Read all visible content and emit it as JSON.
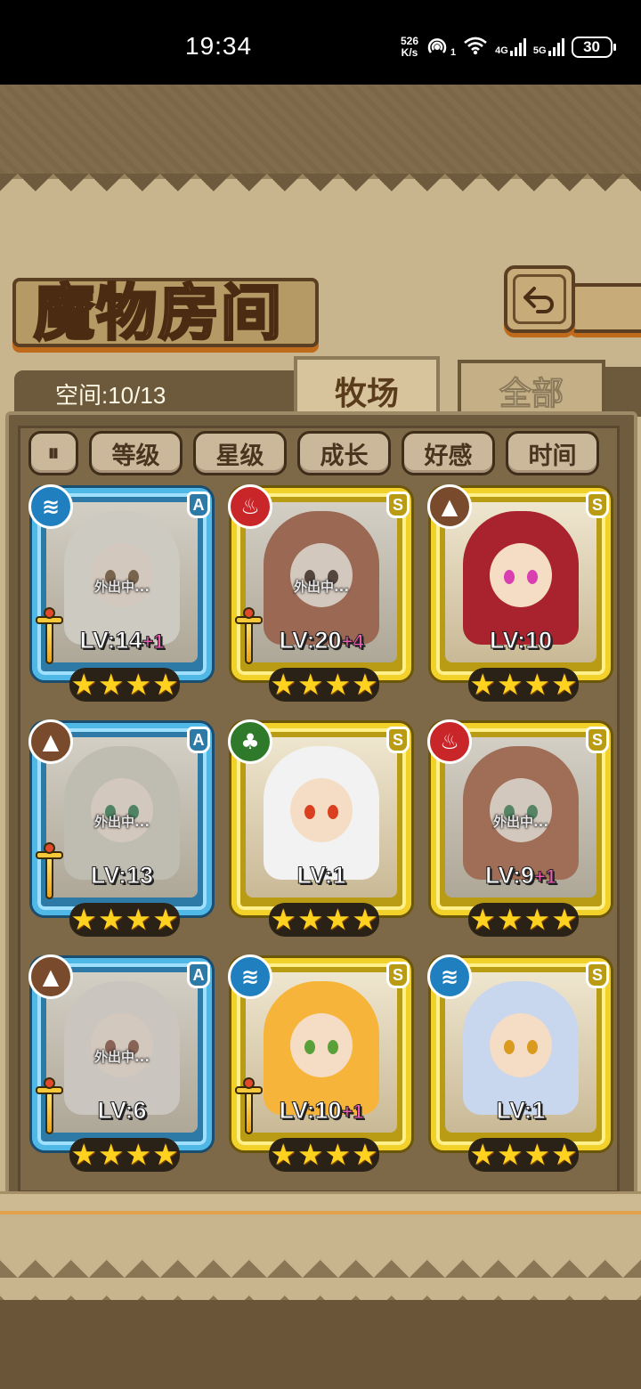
{
  "status_bar": {
    "time": "19:34",
    "net_speed_value": "526",
    "net_speed_unit": "K/s",
    "hotspot_badge": "1",
    "sim1_label": "4G",
    "sim2_label": "5G",
    "battery": "30"
  },
  "header": {
    "title": "魔物房间",
    "back_icon": "back-arrow-icon"
  },
  "space": {
    "label": "空间:10/13"
  },
  "tabs": [
    {
      "label": "牧场",
      "active": true
    },
    {
      "label": "全部",
      "active": false
    }
  ],
  "filters": {
    "sort_icon": "sort-toggle-icon",
    "sort_glyph": "⏸",
    "buttons": [
      "等级",
      "星级",
      "成长",
      "好感",
      "时间"
    ]
  },
  "monster_cards": [
    {
      "rank": "A",
      "element": "water",
      "element_icon": "water-element-icon",
      "element_glyph": "≋",
      "element_color": "#1f7fbf",
      "status": "外出中...",
      "level": "LV:14",
      "bonus": "+1",
      "has_weapon": true,
      "stars": 4,
      "hair_color": "#e8e0cc",
      "eye_color": "#9a6b3a"
    },
    {
      "rank": "S",
      "element": "fire",
      "element_icon": "fire-element-icon",
      "element_glyph": "♨",
      "element_color": "#c9262a",
      "status": "外出中...",
      "level": "LV:20",
      "bonus": "+4",
      "has_weapon": true,
      "stars": 4,
      "hair_color": "#d96a3a",
      "eye_color": "#6b4a3a"
    },
    {
      "rank": "S",
      "element": "earth",
      "element_icon": "earth-element-icon",
      "element_glyph": "▲",
      "element_color": "#7a4a2c",
      "status": "",
      "level": "LV:10",
      "bonus": "",
      "has_weapon": false,
      "stars": 4,
      "hair_color": "#a8232d",
      "eye_color": "#d93fb0"
    },
    {
      "rank": "A",
      "element": "earth",
      "element_icon": "earth-element-icon",
      "element_glyph": "▲",
      "element_color": "#7a4a2c",
      "status": "外出中...",
      "level": "LV:13",
      "bonus": "",
      "has_weapon": true,
      "stars": 4,
      "hair_color": "#d8d2b8",
      "eye_color": "#2ea05a"
    },
    {
      "rank": "S",
      "element": "nature",
      "element_icon": "leaf-element-icon",
      "element_glyph": "♣",
      "element_color": "#2f7a2a",
      "status": "",
      "level": "LV:1",
      "bonus": "",
      "has_weapon": false,
      "stars": 4,
      "hair_color": "#f2f2f2",
      "eye_color": "#d9401f"
    },
    {
      "rank": "S",
      "element": "fire",
      "element_icon": "fire-element-icon",
      "element_glyph": "♨",
      "element_color": "#c9262a",
      "status": "外出中...",
      "level": "LV:9",
      "bonus": "+1",
      "has_weapon": false,
      "stars": 4,
      "hair_color": "#e0703c",
      "eye_color": "#3aa05a"
    },
    {
      "rank": "A",
      "element": "earth",
      "element_icon": "earth-element-icon",
      "element_glyph": "▲",
      "element_color": "#7a4a2c",
      "status": "外出中...",
      "level": "LV:6",
      "bonus": "",
      "has_weapon": true,
      "stars": 4,
      "hair_color": "#e4dccc",
      "eye_color": "#b8664a"
    },
    {
      "rank": "S",
      "element": "water",
      "element_icon": "water-element-icon",
      "element_glyph": "≋",
      "element_color": "#1f7fbf",
      "status": "",
      "level": "LV:10",
      "bonus": "+1",
      "has_weapon": true,
      "stars": 4,
      "hair_color": "#f7b43a",
      "eye_color": "#5aa03a"
    },
    {
      "rank": "S",
      "element": "water",
      "element_icon": "water-element-icon",
      "element_glyph": "≋",
      "element_color": "#1f7fbf",
      "status": "",
      "level": "LV:1",
      "bonus": "",
      "has_weapon": false,
      "stars": 4,
      "hair_color": "#c8d6ee",
      "eye_color": "#d99a1f"
    }
  ]
}
